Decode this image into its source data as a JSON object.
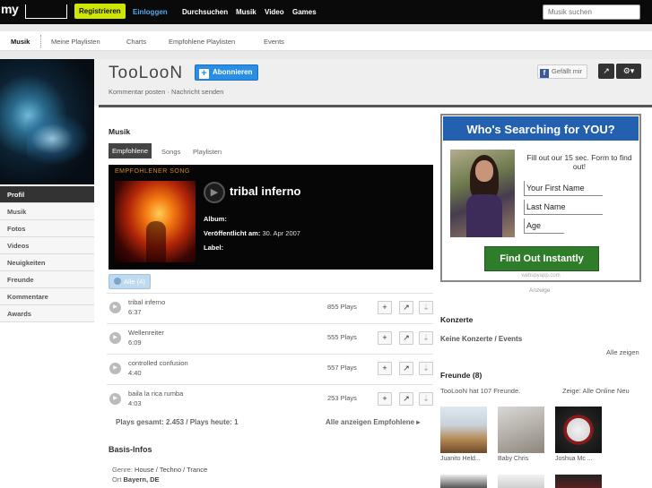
{
  "topbar": {
    "logo": "my",
    "register": "Registrieren",
    "login": "Einloggen",
    "nav": [
      "Durchsuchen",
      "Musik",
      "Video",
      "Games"
    ],
    "search_placeholder": "Musik suchen"
  },
  "subnav": [
    "Musik",
    "Meine Playlisten",
    "Charts",
    "Empfohlene Playlisten",
    "Events"
  ],
  "sidebar": {
    "items": [
      "Profil",
      "Musik",
      "Fotos",
      "Videos",
      "Neuigkeiten",
      "Freunde",
      "Kommentare",
      "Awards"
    ]
  },
  "profile": {
    "name": "TooLooN",
    "subscribe": "Abonnieren",
    "links": "Kommentar posten · Nachricht senden",
    "like": "Gefällt mir"
  },
  "music": {
    "title": "Musik",
    "tabs": [
      "Empfohlene",
      "Songs",
      "Playlisten"
    ],
    "featured": {
      "label": "EMPFOHLENER SONG",
      "title": "tribal inferno",
      "album_label": "Album:",
      "album": "",
      "released_label": "Veröffentlicht am:",
      "released": "30. Apr 2007",
      "label_label": "Label:",
      "record_label": ""
    },
    "all_button": "Alle (4)",
    "tracks": [
      {
        "name": "tribal inferno",
        "duration": "6:37",
        "plays": "855 Plays"
      },
      {
        "name": "Wellenreiter",
        "duration": "6:09",
        "plays": "555 Plays"
      },
      {
        "name": "controlled confusion",
        "duration": "4:40",
        "plays": "557 Plays"
      },
      {
        "name": "baila la rica rumba",
        "duration": "4:03",
        "plays": "253 Plays"
      }
    ],
    "plays_total": "Plays gesamt: 2.453 / Plays heute: 1",
    "show_all": "Alle anzeigen Empfohlene ▸"
  },
  "basis": {
    "title": "Basis-Infos",
    "genre_label": "Genre:",
    "genre": "House / Techno / Trance",
    "ort_label": "Ort",
    "ort": "Bayern, DE"
  },
  "ad": {
    "headline": "Who's Searching for YOU?",
    "text": "Fill out our 15 sec. Form to find out!",
    "first_name": "Your First Name",
    "last_name": "Last Name",
    "age": "Age",
    "button": "Find Out Instantly",
    "url": "webspyapp.com",
    "note": "Anzeige"
  },
  "concerts": {
    "title": "Konzerte",
    "none": "Keine Konzerte / Events",
    "show_all": "Alle zeigen"
  },
  "friends": {
    "title": "Freunde (8)",
    "count_text": "TooLooN hat 107 Freunde.",
    "show_label": "Zeige:",
    "filters": [
      "Alle",
      "Online",
      "Neu"
    ],
    "names": [
      "Juanito Held...",
      "Baby Chris",
      "Joshua Mc ..."
    ]
  }
}
